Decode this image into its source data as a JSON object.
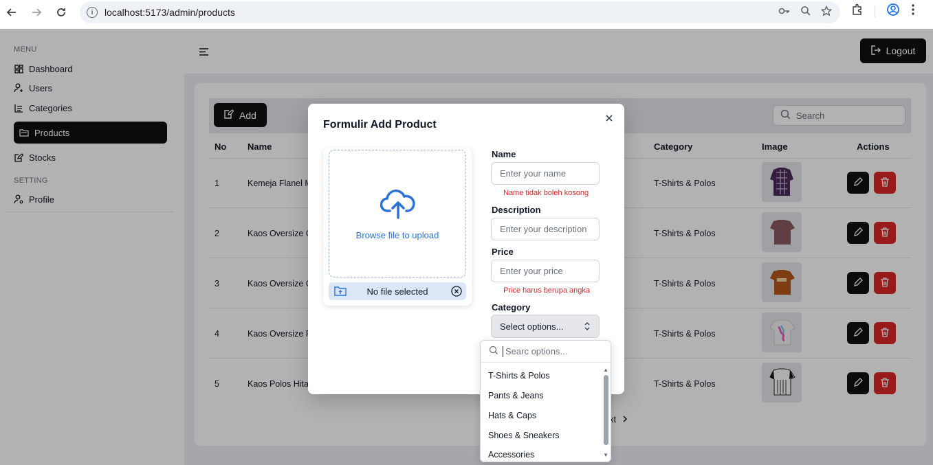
{
  "browser": {
    "url": "localhost:5173/admin/products"
  },
  "sidebar": {
    "menu_label": "MENU",
    "setting_label": "SETTING",
    "items": [
      {
        "label": "Dashboard",
        "icon": "dashboard-icon"
      },
      {
        "label": "Users",
        "icon": "user-add-icon"
      },
      {
        "label": "Categories",
        "icon": "categories-icon"
      },
      {
        "label": "Products",
        "icon": "folder-icon",
        "active": true
      },
      {
        "label": "Stocks",
        "icon": "edit-document-icon"
      },
      {
        "label": "Profile",
        "icon": "profile-icon"
      }
    ]
  },
  "header": {
    "logout_label": "Logout"
  },
  "toolbar": {
    "add_label": "Add",
    "search_placeholder": "Search"
  },
  "table": {
    "columns": [
      "No",
      "Name",
      "Category",
      "Image",
      "Actions"
    ],
    "rows": [
      {
        "no": "1",
        "name": "Kemeja Flanel M",
        "category": "T-Shirts & Polos"
      },
      {
        "no": "2",
        "name": "Kaos Oversize C",
        "category": "T-Shirts & Polos"
      },
      {
        "no": "3",
        "name": "Kaos Oversize C",
        "category": "T-Shirts & Polos"
      },
      {
        "no": "4",
        "name": "Kaos Oversize P",
        "category": "T-Shirts & Polos"
      },
      {
        "no": "5",
        "name": "Kaos Polos Hitan",
        "category": "T-Shirts & Polos"
      }
    ],
    "pagination_next": "xt"
  },
  "modal": {
    "title": "Formulir Add Product",
    "upload": {
      "browse_label": "Browse file to upload",
      "file_status": "No file selected"
    },
    "fields": {
      "name_label": "Name",
      "name_placeholder": "Enter your name",
      "name_error": "Name tidak boleh kosong",
      "description_label": "Description",
      "description_placeholder": "Enter your description",
      "price_label": "Price",
      "price_placeholder": "Enter your price",
      "price_error": "Price harus berupa angka",
      "category_label": "Category",
      "category_value": "Select options..."
    },
    "dropdown": {
      "search_value": "Searc options...",
      "options": [
        "T-Shirts & Polos",
        "Pants & Jeans",
        "Hats & Caps",
        "Shoes & Sneakers",
        "Accessories"
      ]
    }
  },
  "colors": {
    "primary_dark": "#111111",
    "danger": "#dc2626",
    "accent_blue": "#2b73d9"
  }
}
